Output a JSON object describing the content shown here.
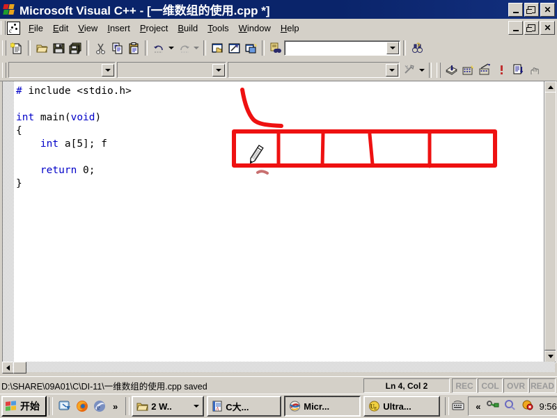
{
  "window": {
    "title": "Microsoft Visual C++ - [一维数组的使用.cpp *]",
    "app_icon": "vc-windows-logo-icon",
    "buttons": {
      "minimize": "_",
      "maximize": "□",
      "close": "×"
    }
  },
  "menubar": {
    "doc_icon": "cpp-document-icon",
    "items": [
      {
        "label": "File",
        "accel": "F"
      },
      {
        "label": "Edit",
        "accel": "E"
      },
      {
        "label": "View",
        "accel": "V"
      },
      {
        "label": "Insert",
        "accel": "I"
      },
      {
        "label": "Project",
        "accel": "P"
      },
      {
        "label": "Build",
        "accel": "B"
      },
      {
        "label": "Tools",
        "accel": "T"
      },
      {
        "label": "Window",
        "accel": "W"
      },
      {
        "label": "Help",
        "accel": "H"
      }
    ],
    "child_buttons": {
      "minimize": "_",
      "restore": "□",
      "close": "×"
    }
  },
  "toolbar_standard": {
    "icons": [
      "new-text-file-icon",
      "open-folder-icon",
      "save-icon",
      "save-all-icon",
      "cut-scissors-icon",
      "copy-icon",
      "paste-icon",
      "undo-icon",
      "redo-icon",
      "workspace-icon",
      "output-window-icon",
      "class-wizard-icon",
      "find-in-files-icon"
    ],
    "find_box": {
      "value": "",
      "placeholder": ""
    },
    "find_next_icon": "binoculars-search-icon"
  },
  "toolbar_build": {
    "combo_configuration": {
      "value": ""
    },
    "combo_class": {
      "value": ""
    },
    "combo_member": {
      "value": ""
    },
    "wizardbar_icon": "wizardbar-actions-icon",
    "icons": [
      "compile-icon",
      "build-icon",
      "stop-build-icon",
      "execute-program-icon",
      "go-debug-icon",
      "insert-breakpoint-icon"
    ]
  },
  "editor": {
    "cursor_icon": "pencil-annotation-cursor",
    "code_lines": [
      {
        "indent": 0,
        "parts": [
          {
            "t": "# include <stdio.h>",
            "kw": true
          }
        ]
      },
      {
        "indent": 0,
        "parts": [
          {
            "t": "",
            "kw": false
          }
        ]
      },
      {
        "indent": 0,
        "parts": [
          {
            "t": "int ",
            "kw": true
          },
          {
            "t": "main(",
            "kw": false
          },
          {
            "t": "void",
            "kw": true
          },
          {
            "t": ")",
            "kw": false
          }
        ]
      },
      {
        "indent": 0,
        "parts": [
          {
            "t": "{",
            "kw": false
          }
        ]
      },
      {
        "indent": 1,
        "parts": [
          {
            "t": "int ",
            "kw": true
          },
          {
            "t": "a[5]; f",
            "kw": false
          }
        ]
      },
      {
        "indent": 0,
        "parts": [
          {
            "t": "",
            "kw": false
          }
        ]
      },
      {
        "indent": 1,
        "parts": [
          {
            "t": "return ",
            "kw": true
          },
          {
            "t": "0;",
            "kw": false
          }
        ]
      },
      {
        "indent": 0,
        "parts": [
          {
            "t": "}",
            "kw": false
          }
        ]
      }
    ],
    "code_text": "# include <stdio.h>\n\nint main(void)\n{\n    int a[5]; f\n\n    return 0;\n}",
    "annotation": {
      "type": "hand-drawn-red-ink",
      "color": "#ee1111",
      "description": "red array box divided into 5 cells with a curved pointer stroke above",
      "cell_count": 5
    }
  },
  "statusbar": {
    "message": "D:\\SHARE\\09A01\\C\\DI-11\\一维数组的使用.cpp saved",
    "position": "Ln 4, Col 2",
    "indicators": [
      "REC",
      "COL",
      "OVR",
      "READ"
    ]
  },
  "taskbar": {
    "start_label": "开始",
    "start_icon": "windows-flag-icon",
    "quicklaunch": [
      {
        "icon": "show-desktop-icon"
      },
      {
        "icon": "firefox-icon"
      },
      {
        "icon": "browser-e-icon"
      }
    ],
    "overflow": "»",
    "tasks": [
      {
        "label": "2 W..",
        "icon": "folder-icon",
        "active": false,
        "group": true
      },
      {
        "label": "C大...",
        "icon": "wordpad-doc-icon",
        "active": false
      },
      {
        "label": "Micr...",
        "icon": "visual-cpp-icon",
        "active": true
      },
      {
        "label": "Ultra...",
        "icon": "ultraedit-icon",
        "active": false
      }
    ],
    "tray": {
      "icons": [
        "keyboard-ime-icon",
        "show-hidden-chevron-icon",
        "network-key-icon",
        "volume-icon",
        "antivirus-alert-icon"
      ],
      "chevron": "«",
      "clock": "9:56"
    }
  },
  "colors": {
    "titlebar": "#0a246a",
    "face": "#d4d0c8",
    "keyword": "#0000c8",
    "annotation": "#ee1111"
  }
}
